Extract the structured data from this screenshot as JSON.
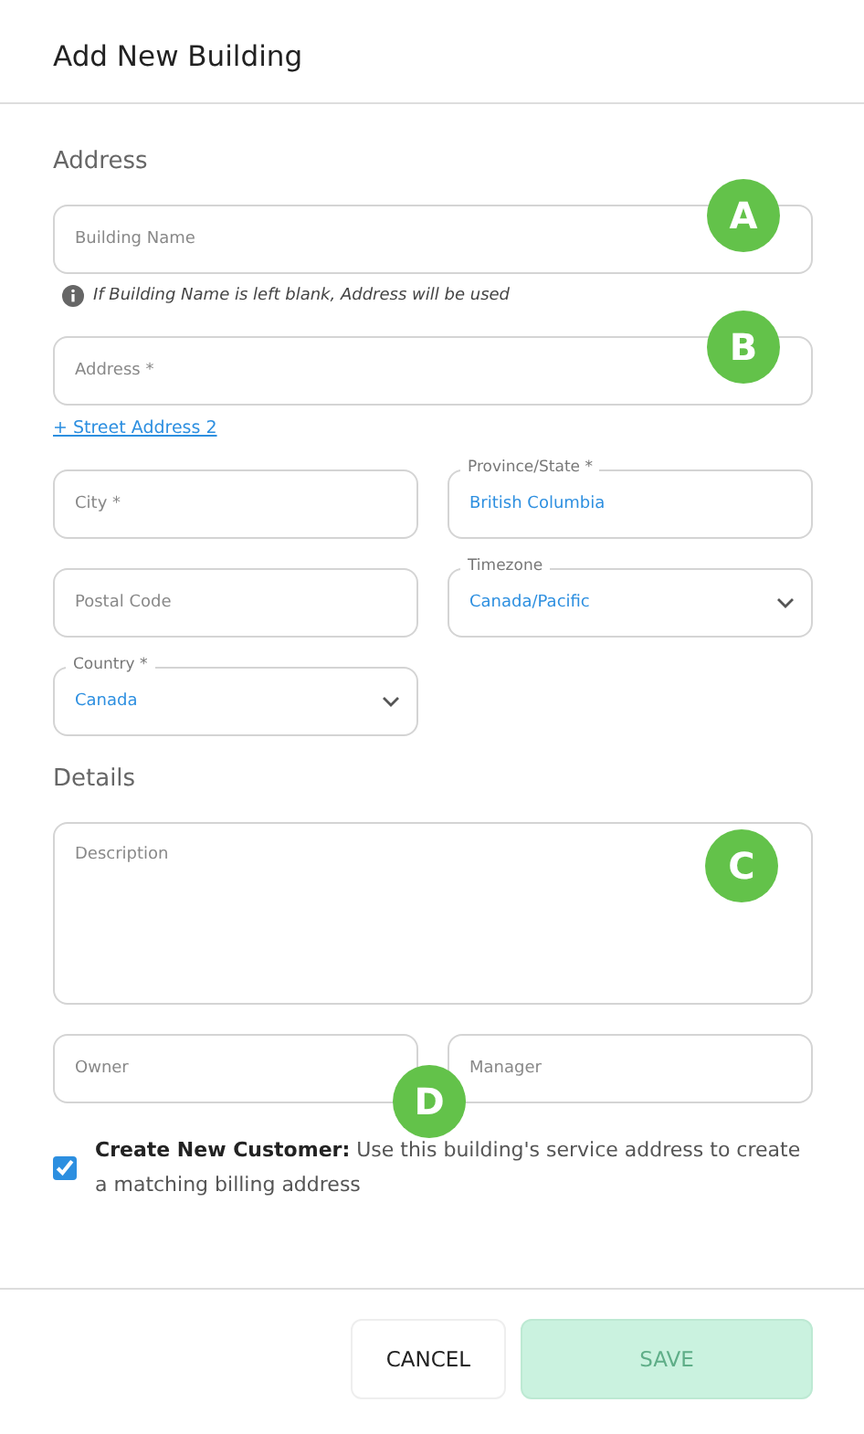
{
  "dialog": {
    "title": "Add New Building"
  },
  "sections": [
    {
      "heading": "Address",
      "rows": [
        [
          {
            "kind": "text",
            "placeholder": "Building Name",
            "hint": "If Building Name is left blank, Address will be used"
          }
        ],
        [
          {
            "kind": "text",
            "placeholder": "Address *",
            "link": "+ Street Address 2"
          }
        ],
        [
          {
            "kind": "text",
            "placeholder": "City *"
          },
          {
            "kind": "text",
            "label": "Province/State *",
            "value": "British Columbia"
          }
        ],
        [
          {
            "kind": "text",
            "placeholder": "Postal Code"
          },
          {
            "kind": "select",
            "label": "Timezone",
            "value": "Canada/Pacific"
          }
        ],
        [
          {
            "kind": "select",
            "label": "Country *",
            "value": "Canada"
          }
        ]
      ]
    },
    {
      "heading": "Details",
      "rows": [
        [
          {
            "kind": "textarea",
            "placeholder": "Description"
          }
        ],
        [
          {
            "kind": "text",
            "placeholder": "Owner"
          },
          {
            "kind": "text",
            "placeholder": "Manager"
          }
        ]
      ]
    }
  ],
  "checkbox": {
    "checked": true,
    "text": "**Create New Customer:** Use this building's service address to create a matching billing address"
  },
  "buttons": [
    {
      "kind": "secondary",
      "label": "CANCEL",
      "disabled": false
    },
    {
      "kind": "primary",
      "label": "SAVE",
      "disabled": true
    }
  ],
  "markers": [
    {
      "label": "A"
    },
    {
      "label": "B"
    },
    {
      "label": "C"
    },
    {
      "label": "D"
    }
  ]
}
